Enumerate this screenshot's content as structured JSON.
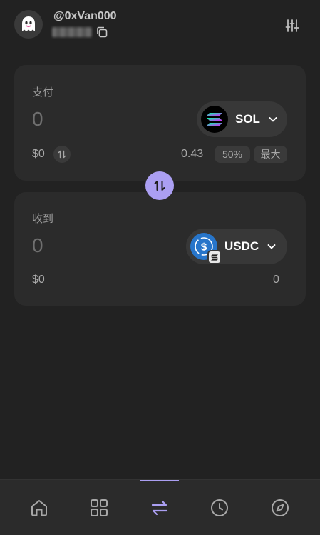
{
  "header": {
    "username": "@0xVan000"
  },
  "pay": {
    "label": "支付",
    "amount_placeholder": "0",
    "token": "SOL",
    "usd_value": "$0",
    "balance": "0.43",
    "half_label": "50%",
    "max_label": "最大"
  },
  "receive": {
    "label": "收到",
    "amount_placeholder": "0",
    "token": "USDC",
    "usd_value": "$0",
    "balance": "0"
  },
  "colors": {
    "background": "#222222",
    "card": "#2b2b2b",
    "accent": "#ab9ff2",
    "usdc_blue": "#2775ca"
  },
  "nav": {
    "items": [
      "home-icon",
      "grid-icon",
      "swap-icon",
      "clock-icon",
      "compass-icon"
    ],
    "active": "swap-icon"
  }
}
